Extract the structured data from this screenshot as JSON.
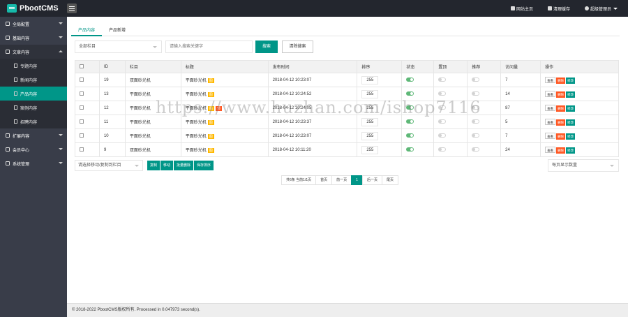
{
  "app": {
    "brand": "PbootCMS"
  },
  "topbar": {
    "site_home": "网站主页",
    "clear_cache": "清理缓存",
    "admin": "超级管理员"
  },
  "sidebar": {
    "items": [
      {
        "label": "全局配置",
        "icon": "globe-icon",
        "open": false
      },
      {
        "label": "基础内容",
        "icon": "sliders-icon",
        "open": false
      },
      {
        "label": "文章内容",
        "icon": "document-icon",
        "open": true,
        "children": [
          {
            "label": "专题内容",
            "active": false
          },
          {
            "label": "新闻内容",
            "active": false
          },
          {
            "label": "产品内容",
            "active": true
          },
          {
            "label": "案例内容",
            "active": false
          },
          {
            "label": "招聘内容",
            "active": false
          }
        ]
      },
      {
        "label": "扩展内容",
        "icon": "puzzle-icon",
        "open": false
      },
      {
        "label": "会员中心",
        "icon": "user-icon",
        "open": false
      },
      {
        "label": "系统管理",
        "icon": "gear-icon",
        "open": false
      }
    ]
  },
  "tabs": [
    "产品内容",
    "产品新增"
  ],
  "filter": {
    "category": "全部栏目",
    "keyword_placeholder": "请输入搜索关键字",
    "search": "搜索",
    "clear": "清除搜索"
  },
  "table": {
    "columns": [
      "ID",
      "栏目",
      "标题",
      "发布时间",
      "排序",
      "状态",
      "置顶",
      "推荐",
      "访问量",
      "操作"
    ],
    "rows": [
      {
        "id": "19",
        "category": "双面砂光机",
        "title": "平面砂光机",
        "badges": [
          "图"
        ],
        "date": "2018-04-12 10:23:07",
        "sort": "255",
        "status": true,
        "top": false,
        "recommend": false,
        "visits": "7"
      },
      {
        "id": "13",
        "category": "平面砂光机",
        "title": "平面砂光机",
        "badges": [
          "图"
        ],
        "date": "2018-04-12 10:24:52",
        "sort": "255",
        "status": true,
        "top": false,
        "recommend": false,
        "visits": "14"
      },
      {
        "id": "12",
        "category": "平面砂光机",
        "title": "平面砂光机",
        "badges": [
          "图",
          "顶"
        ],
        "date": "2018-04-12 10:24:05",
        "sort": "255",
        "status": true,
        "top": false,
        "recommend": false,
        "visits": "87"
      },
      {
        "id": "11",
        "category": "平面砂光机",
        "title": "平面砂光机",
        "badges": [
          "图"
        ],
        "date": "2018-04-12 10:23:37",
        "sort": "255",
        "status": true,
        "top": false,
        "recommend": false,
        "visits": "5"
      },
      {
        "id": "10",
        "category": "平面砂光机",
        "title": "平面砂光机",
        "badges": [
          "图"
        ],
        "date": "2018-04-12 10:23:07",
        "sort": "255",
        "status": true,
        "top": false,
        "recommend": false,
        "visits": "7"
      },
      {
        "id": "9",
        "category": "双面砂光机",
        "title": "平面砂光机",
        "badges": [
          "图"
        ],
        "date": "2018-04-12 10:11:20",
        "sort": "255",
        "status": true,
        "top": false,
        "recommend": false,
        "visits": "24"
      }
    ],
    "actions": {
      "view": "查看",
      "delete": "删除",
      "edit": "修改"
    }
  },
  "batch": {
    "select_placeholder": "请选择移动/复制到栏目",
    "copy": "复制",
    "move": "移动",
    "batch_delete": "批量删除",
    "save_sort": "保存排序"
  },
  "perpage": {
    "label": "每页显示数量"
  },
  "pager": {
    "summary": "共6条 当前1/1页",
    "first": "首页",
    "prev": "前一页",
    "current": "1",
    "next": "后一页",
    "last": "尾页"
  },
  "footer": {
    "text": "© 2018-2022 PbootCMS版权所有. Processed in 0.047973 second(s)."
  },
  "watermark": "https://www.huzhan.com/ishop7116",
  "colors": {
    "accent": "#009688",
    "sidebar": "#393d49",
    "topbar": "#23262e",
    "danger": "#ff5722",
    "warn": "#ffb800"
  }
}
